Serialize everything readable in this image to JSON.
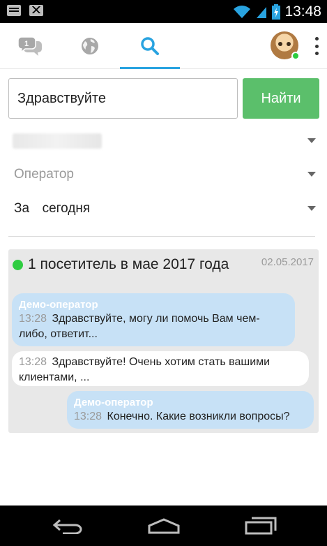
{
  "status_bar": {
    "time": "13:48",
    "left_icons": [
      "message-icon",
      "gmail-icon"
    ],
    "right_icons": [
      "wifi-icon",
      "signal-icon",
      "battery-charging-icon"
    ]
  },
  "tabs": {
    "chats_badge": "1",
    "items": [
      "chats-icon",
      "globe-icon",
      "search-icon"
    ],
    "active": "search"
  },
  "search": {
    "value": "Здравствуйте",
    "button_label": "Найти"
  },
  "filters": {
    "site": "",
    "operator": "Оператор",
    "period": "За  сегодня"
  },
  "result": {
    "title": "1 посетитель в мае 2017 года",
    "date": "02.05.2017",
    "messages": [
      {
        "kind": "operator",
        "author": "Демо-оператор",
        "time": "13:28",
        "text": "Здравствуйте, могу ли помочь Вам чем-либо, ответит..."
      },
      {
        "kind": "visitor",
        "author": "",
        "time": "13:28",
        "text": "Здравствуйте! Очень хотим стать вашими клиентами, ..."
      },
      {
        "kind": "operator",
        "author": "Демо-оператор",
        "time": "13:28",
        "text": "Конечно. Какие возникли вопросы?"
      }
    ]
  },
  "colors": {
    "accent": "#29a3e0",
    "button_green": "#5bbf6b",
    "online": "#2ecc40",
    "operator_bubble": "#c7e1f6",
    "card_bg": "#e8e8e8"
  }
}
